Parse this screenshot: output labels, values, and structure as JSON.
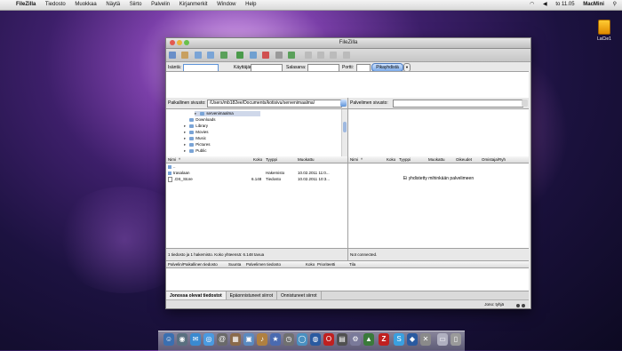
{
  "menubar": {
    "app": "FileZilla",
    "menus": [
      "Tiedosto",
      "Muokkaa",
      "Näytä",
      "Siirto",
      "Palvelin",
      "Kirjanmerkit",
      "Window",
      "Help"
    ],
    "clock": "to 11.05",
    "user": "MacMini"
  },
  "desktop": {
    "drive_label": "LaCie1"
  },
  "window": {
    "title": "FileZilla",
    "quickconnect": {
      "host_label": "Isäntä:",
      "user_label": "Käyttäjänimi:",
      "pass_label": "Salasana:",
      "port_label": "Portti:",
      "button": "Pikayhdistä"
    },
    "local": {
      "site_label": "Paikallinen sivusto:",
      "path": "/Users/mb182ee/Documents/kotisivu/servenimaalma/",
      "tree": [
        {
          "name": "servenimaalma",
          "selected": true
        },
        {
          "name": "Downloads"
        },
        {
          "name": "Library"
        },
        {
          "name": "Movies"
        },
        {
          "name": "Music"
        },
        {
          "name": "Pictures"
        },
        {
          "name": "Public"
        }
      ],
      "columns": {
        "name": "Nimi",
        "size": "Koko",
        "type": "Tyyppi",
        "modified": "Muokattu"
      },
      "files": [
        {
          "name": "..",
          "size": "",
          "type": "",
          "modified": ""
        },
        {
          "name": "trasalaan",
          "size": "",
          "type": "Hakemisto",
          "modified": "10.02.2011 11:0..."
        },
        {
          "name": ".DS_Store",
          "size": "6.148",
          "type": "Tiedosto",
          "modified": "10.02.2011 10:3..."
        }
      ],
      "status": "1 tiedosto ja 1 hakemisto. Koko yhteensä: 6.148 tavua"
    },
    "remote": {
      "site_label": "Palvelimen sivusto:",
      "columns": {
        "name": "Nimi",
        "size": "Koko",
        "type": "Tyyppi",
        "modified": "Muokattu",
        "perms": "Oikeudet",
        "owner": "Omistaja/Ryh"
      },
      "empty_message": "Ei yhdistetty mihinkään palvelimeen",
      "status": "Not connected."
    },
    "queue": {
      "columns": {
        "file": "Palvelin/Paikallinen tiedosto",
        "dir": "Suunta",
        "remote": "Palvelimen tiedosto",
        "size": "Koko",
        "priority": "Prioriteetti",
        "state": "Tila"
      },
      "tabs": [
        "Jonossa olevat tiedostot",
        "Epäonnistuneet siirrot",
        "Onnistuneet siirrot"
      ],
      "queue_label": "Jono: tyhjä"
    }
  },
  "colors": {
    "accent": "#7aa9e8",
    "selection": "#cfd8ea"
  }
}
